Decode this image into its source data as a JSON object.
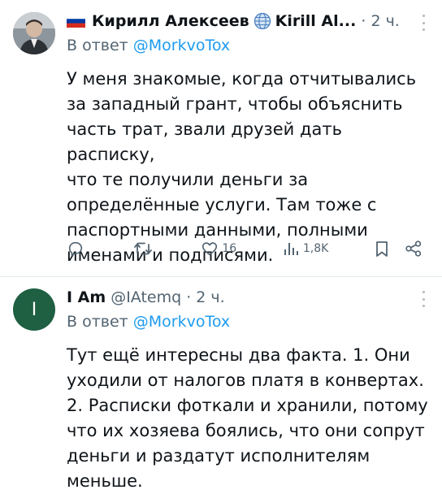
{
  "tweets": [
    {
      "display_name": "Кирилл Алексеев",
      "display_name_latin": "Kirill Al...",
      "time": "2 ч.",
      "reply_prefix": "В ответ ",
      "reply_to": "@MorkvoTox",
      "text": "У меня знакомые, когда отчитывались\nза западный грант, чтобы объяснить\nчасть трат, звали друзей дать расписку,\nчто те получили деньги за\nопределённые услуги. Там тоже с\nпаспортными данными, полными\nименами и подписями.",
      "actions": {
        "reply_count": "",
        "retweet_count": "",
        "like_count": "16",
        "view_count": "1,8K"
      },
      "icons": {
        "flag": "russia-flag-icon",
        "globe": "globe-icon"
      }
    },
    {
      "display_name": "I Am",
      "handle": "@IAtemq",
      "time": "2 ч.",
      "avatar_letter": "I",
      "reply_prefix": "В ответ ",
      "reply_to": "@MorkvoTox",
      "text": "Тут ещё интересны два факта. 1. Они\nуходили от налогов платя в конвертах.\n2. Расписки фоткали и хранили, потому\nчто их хозяева боялись, что они сопрут\nденьги и раздатут исполнителям\nменьше."
    }
  ],
  "colors": {
    "link": "#1d9bf0",
    "secondary_text": "#536471",
    "avatar_bg_2": "#1f5f42"
  }
}
